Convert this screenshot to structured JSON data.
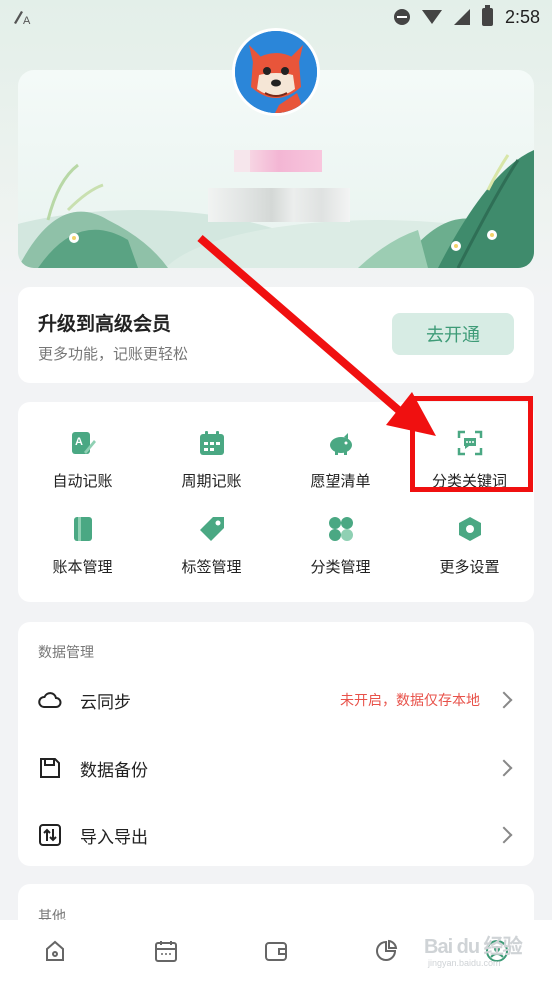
{
  "status_bar": {
    "time": "2:58"
  },
  "vip": {
    "title": "升级到高级会员",
    "subtitle": "更多功能，记账更轻松",
    "button": "去开通"
  },
  "features": [
    {
      "label": "自动记账",
      "icon": "auto-bookkeeping-icon"
    },
    {
      "label": "周期记账",
      "icon": "calendar-icon"
    },
    {
      "label": "愿望清单",
      "icon": "piggy-bank-icon"
    },
    {
      "label": "分类关键词",
      "icon": "scan-message-icon"
    },
    {
      "label": "账本管理",
      "icon": "book-icon"
    },
    {
      "label": "标签管理",
      "icon": "tag-icon"
    },
    {
      "label": "分类管理",
      "icon": "category-grid-icon"
    },
    {
      "label": "更多设置",
      "icon": "settings-hex-icon"
    }
  ],
  "data_management": {
    "title": "数据管理",
    "rows": [
      {
        "label": "云同步",
        "status": "未开启，数据仅存本地",
        "icon": "cloud-icon"
      },
      {
        "label": "数据备份",
        "status": "",
        "icon": "save-icon"
      },
      {
        "label": "导入导出",
        "status": "",
        "icon": "import-export-icon"
      }
    ]
  },
  "other": {
    "title": "其他"
  },
  "tabs": [
    {
      "name": "home-icon"
    },
    {
      "name": "calendar-icon"
    },
    {
      "name": "wallet-icon"
    },
    {
      "name": "pie-chart-icon"
    },
    {
      "name": "profile-icon"
    }
  ],
  "watermark": {
    "text": "Bai du 经验",
    "sub": "jingyan.baidu.com"
  },
  "colors": {
    "accent": "#3e9b77",
    "accent_light": "#d7ece4",
    "alert": "#e8524a",
    "highlight": "#f01010"
  }
}
